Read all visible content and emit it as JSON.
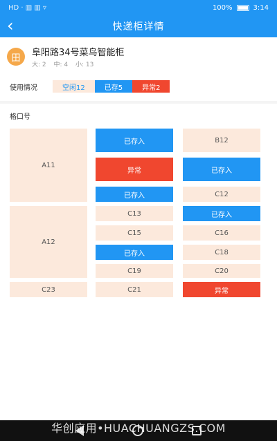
{
  "status_bar": {
    "left_icons": "HD · ▥ ▥ ▿",
    "battery": "100%",
    "time": "3:14"
  },
  "app_bar": {
    "back_icon": "‹",
    "title": "快递柜详情"
  },
  "station": {
    "icon_glyph": "田",
    "name": "阜阳路34号菜鸟智能柜",
    "large": "大: 2",
    "medium": "中: 4",
    "small": "小: 13"
  },
  "usage": {
    "label": "使用情况",
    "free": "空闲12",
    "stored": "已存5",
    "abnormal": "异常2"
  },
  "lockers_title": "格口号",
  "cells": {
    "a11": "A11",
    "a12": "A12",
    "c23": "C23",
    "m1": "已存入",
    "m2": "异常",
    "m3": "已存入",
    "c13": "C13",
    "c15": "C15",
    "m6": "已存入",
    "c19": "C19",
    "c21": "C21",
    "b12": "B12",
    "r2": "已存入",
    "c12": "C12",
    "r4": "已存入",
    "c16": "C16",
    "c18": "C18",
    "c20": "C20",
    "r8": "异常"
  },
  "colors": {
    "accent": "#2196F3",
    "free": "#FCE9DC",
    "abnormal": "#F0472F"
  },
  "watermark": "华创应用•HUACHUANGZS.COM"
}
